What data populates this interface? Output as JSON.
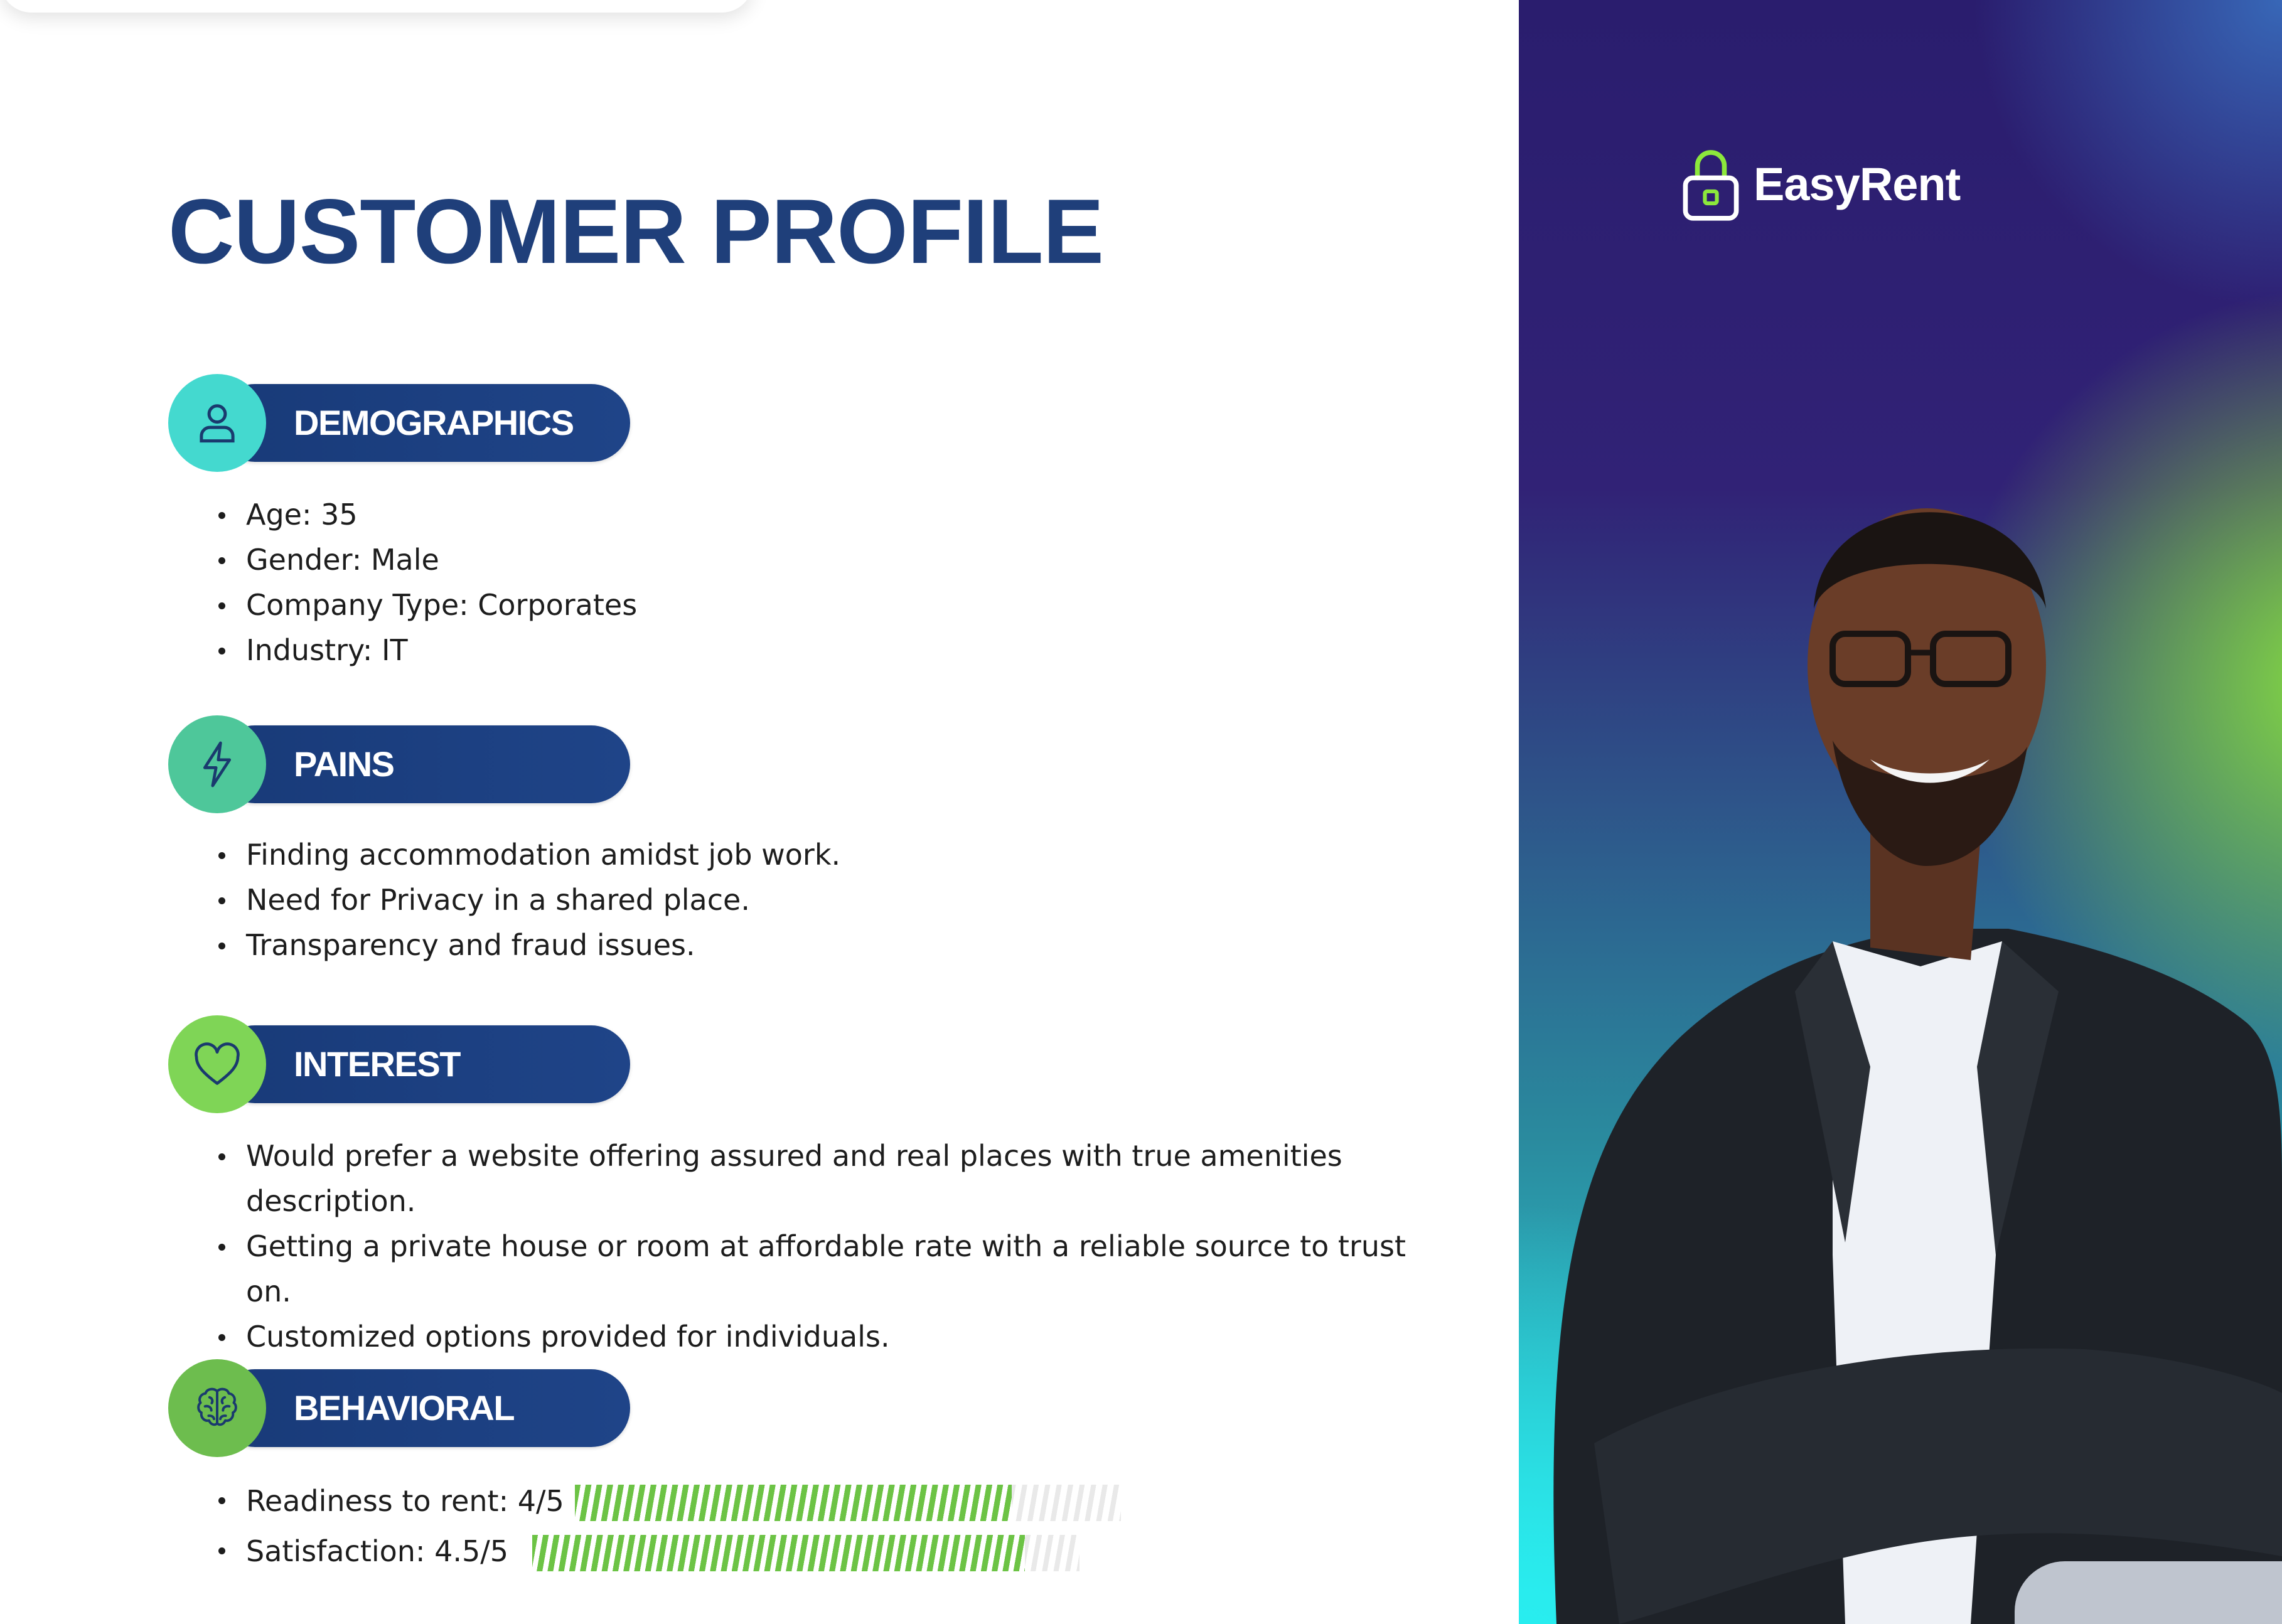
{
  "title": "CUSTOMER PROFILE",
  "brand": {
    "name": "EasyRent",
    "icon": "lock-icon"
  },
  "sections": {
    "demographics": {
      "label": "DEMOGRAPHICS",
      "icon": "person-icon",
      "items": [
        "Age: 35",
        "Gender: Male",
        "Company Type: Corporates",
        "Industry: IT"
      ]
    },
    "pains": {
      "label": "PAINS",
      "icon": "lightning-icon",
      "items": [
        "Finding accommodation amidst job work.",
        "Need for Privacy in a shared place.",
        "Transparency and fraud issues."
      ]
    },
    "interest": {
      "label": "INTEREST",
      "icon": "heart-icon",
      "items": [
        "Would prefer a website offering assured and real places with true amenities description.",
        "Getting a private house or room at affordable rate with a reliable source to trust on.",
        "Customized options provided for individuals."
      ]
    },
    "behavioral": {
      "label": "BEHAVIORAL",
      "icon": "brain-icon",
      "ratings": [
        {
          "label": "Readiness to rent: 4/5",
          "value": 4,
          "max": 5
        },
        {
          "label": "Satisfaction: 4.5/5",
          "value": 4.5,
          "max": 5
        }
      ]
    }
  },
  "colors": {
    "title": "#1f3f7a",
    "pill": "#183a78",
    "bar_fill": "#6cc345",
    "panel_top": "#2a1d6e",
    "panel_bottom": "#2ee3e6",
    "panel_accent": "#8ce83c"
  }
}
